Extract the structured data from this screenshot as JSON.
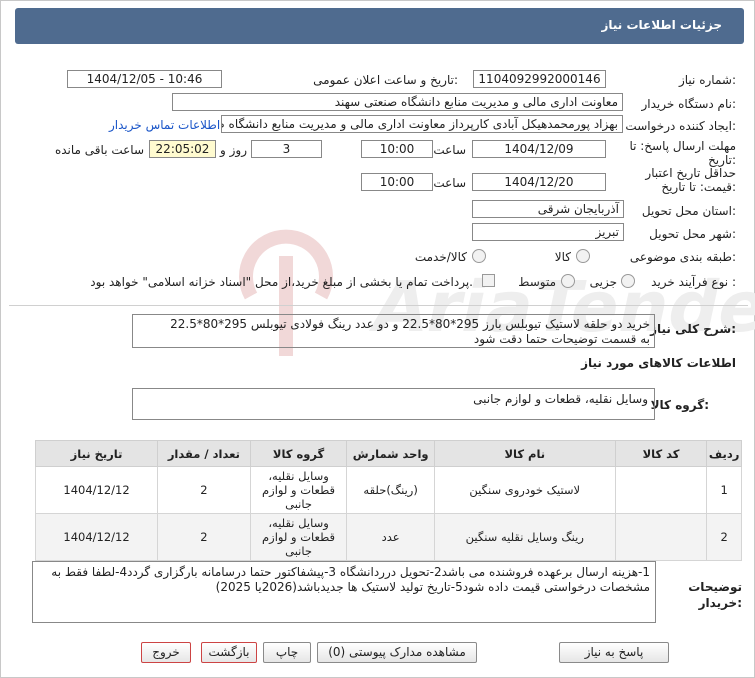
{
  "header": {
    "title": "جزئیات اطلاعات نیاز"
  },
  "fields": {
    "need_number_label": "شماره نیاز:",
    "need_number": "1104092992000146",
    "announce_label": "تاریخ و ساعت اعلان عمومی:",
    "announce_value": "1404/12/05 - 10:46",
    "buyer_org_label": "نام دستگاه خریدار:",
    "buyer_org": "معاونت اداری  مالی و مدیریت منابع دانشگاه صنعتی سهند",
    "creator_label": "ایجاد کننده درخواست:",
    "creator": "بهزاد پورمحمدهیکل آبادی کارپرداز معاونت اداری  مالی و مدیریت منابع دانشگاه صنعتی سهند",
    "contact_link": "اطلاعات تماس خریدار",
    "deadline_label": "مهلت ارسال پاسخ: تا تاریخ:",
    "deadline_date": "1404/12/09",
    "time_label": "ساعت",
    "deadline_time": "10:00",
    "days_value": "3",
    "days_label": "روز و",
    "remaining_time": "22:05:02",
    "remaining_label": "ساعت باقی مانده",
    "validity_label": "حداقل تاریخ اعتبار قیمت: تا تاریخ:",
    "validity_date": "1404/12/20",
    "validity_time": "10:00",
    "province_label": "استان محل تحویل:",
    "province": "آذربایجان شرقی",
    "city_label": "شهر محل تحویل:",
    "city": "تبریز",
    "category_label": "طبقه بندی موضوعی:",
    "category_options": [
      "کالا",
      "کالا/خدمت"
    ],
    "process_label": "نوع فرآیند خرید :",
    "process_options": [
      "جزیی",
      "متوسط"
    ],
    "payment_note": "پرداخت تمام یا بخشی از مبلغ خرید،از محل \"اسناد خزانه اسلامی\" خواهد بود."
  },
  "summary": {
    "label": "شرح کلی نیاز:",
    "text_line1": "خرید دو حلقه لاستیک تیوبلس بارز 295*80*22.5 و دو عدد رینگ فولادی تیوبلس 295*80*22.5",
    "text_line2": "به قسمت توضیحات حتما دقت شود"
  },
  "goods": {
    "section_title": "اطلاعات کالاهای مورد نیاز",
    "group_label": "گروه کالا:",
    "group_value": "وسایل نقلیه، قطعات و لوازم جانبی"
  },
  "table": {
    "headers": [
      "ردیف",
      "کد کالا",
      "نام کالا",
      "واحد شمارش",
      "گروه کالا",
      "تعداد / مقدار",
      "تاریخ نیاز"
    ],
    "rows": [
      {
        "row": "1",
        "code": "",
        "name": "لاستیک خودروی سنگین",
        "unit": "(رینگ)حلقه",
        "group": "وسایل نقلیه، قطعات و لوازم جانبی",
        "qty": "2",
        "date": "1404/12/12"
      },
      {
        "row": "2",
        "code": "",
        "name": "رینگ وسایل نقلیه سنگین",
        "unit": "عدد",
        "group": "وسایل نقلیه، قطعات و لوازم جانبی",
        "qty": "2",
        "date": "1404/12/12"
      }
    ]
  },
  "notes": {
    "label": "توضیحات خریدار:",
    "line1": "1-هزینه ارسال برعهده فروشنده می باشد2-تحویل درردانشگاه 3-پیشفاکتور حتما درسامانه بارگزاری گردد4-لطفا فقط به",
    "line2": "مشخصات درخواستی قیمت داده شود5-تاریخ تولید لاستیک ها جدیدباشد(2026یا 2025)"
  },
  "buttons": {
    "reply": "پاسخ به نیاز",
    "attachments": "مشاهده مدارک پیوستی (0)",
    "print": "چاپ",
    "back": "بازگشت",
    "exit": "خروج"
  },
  "colors": {
    "title_bar": "#4f6b8f",
    "highlight": "#fffbd0",
    "link": "#1a55c8"
  }
}
